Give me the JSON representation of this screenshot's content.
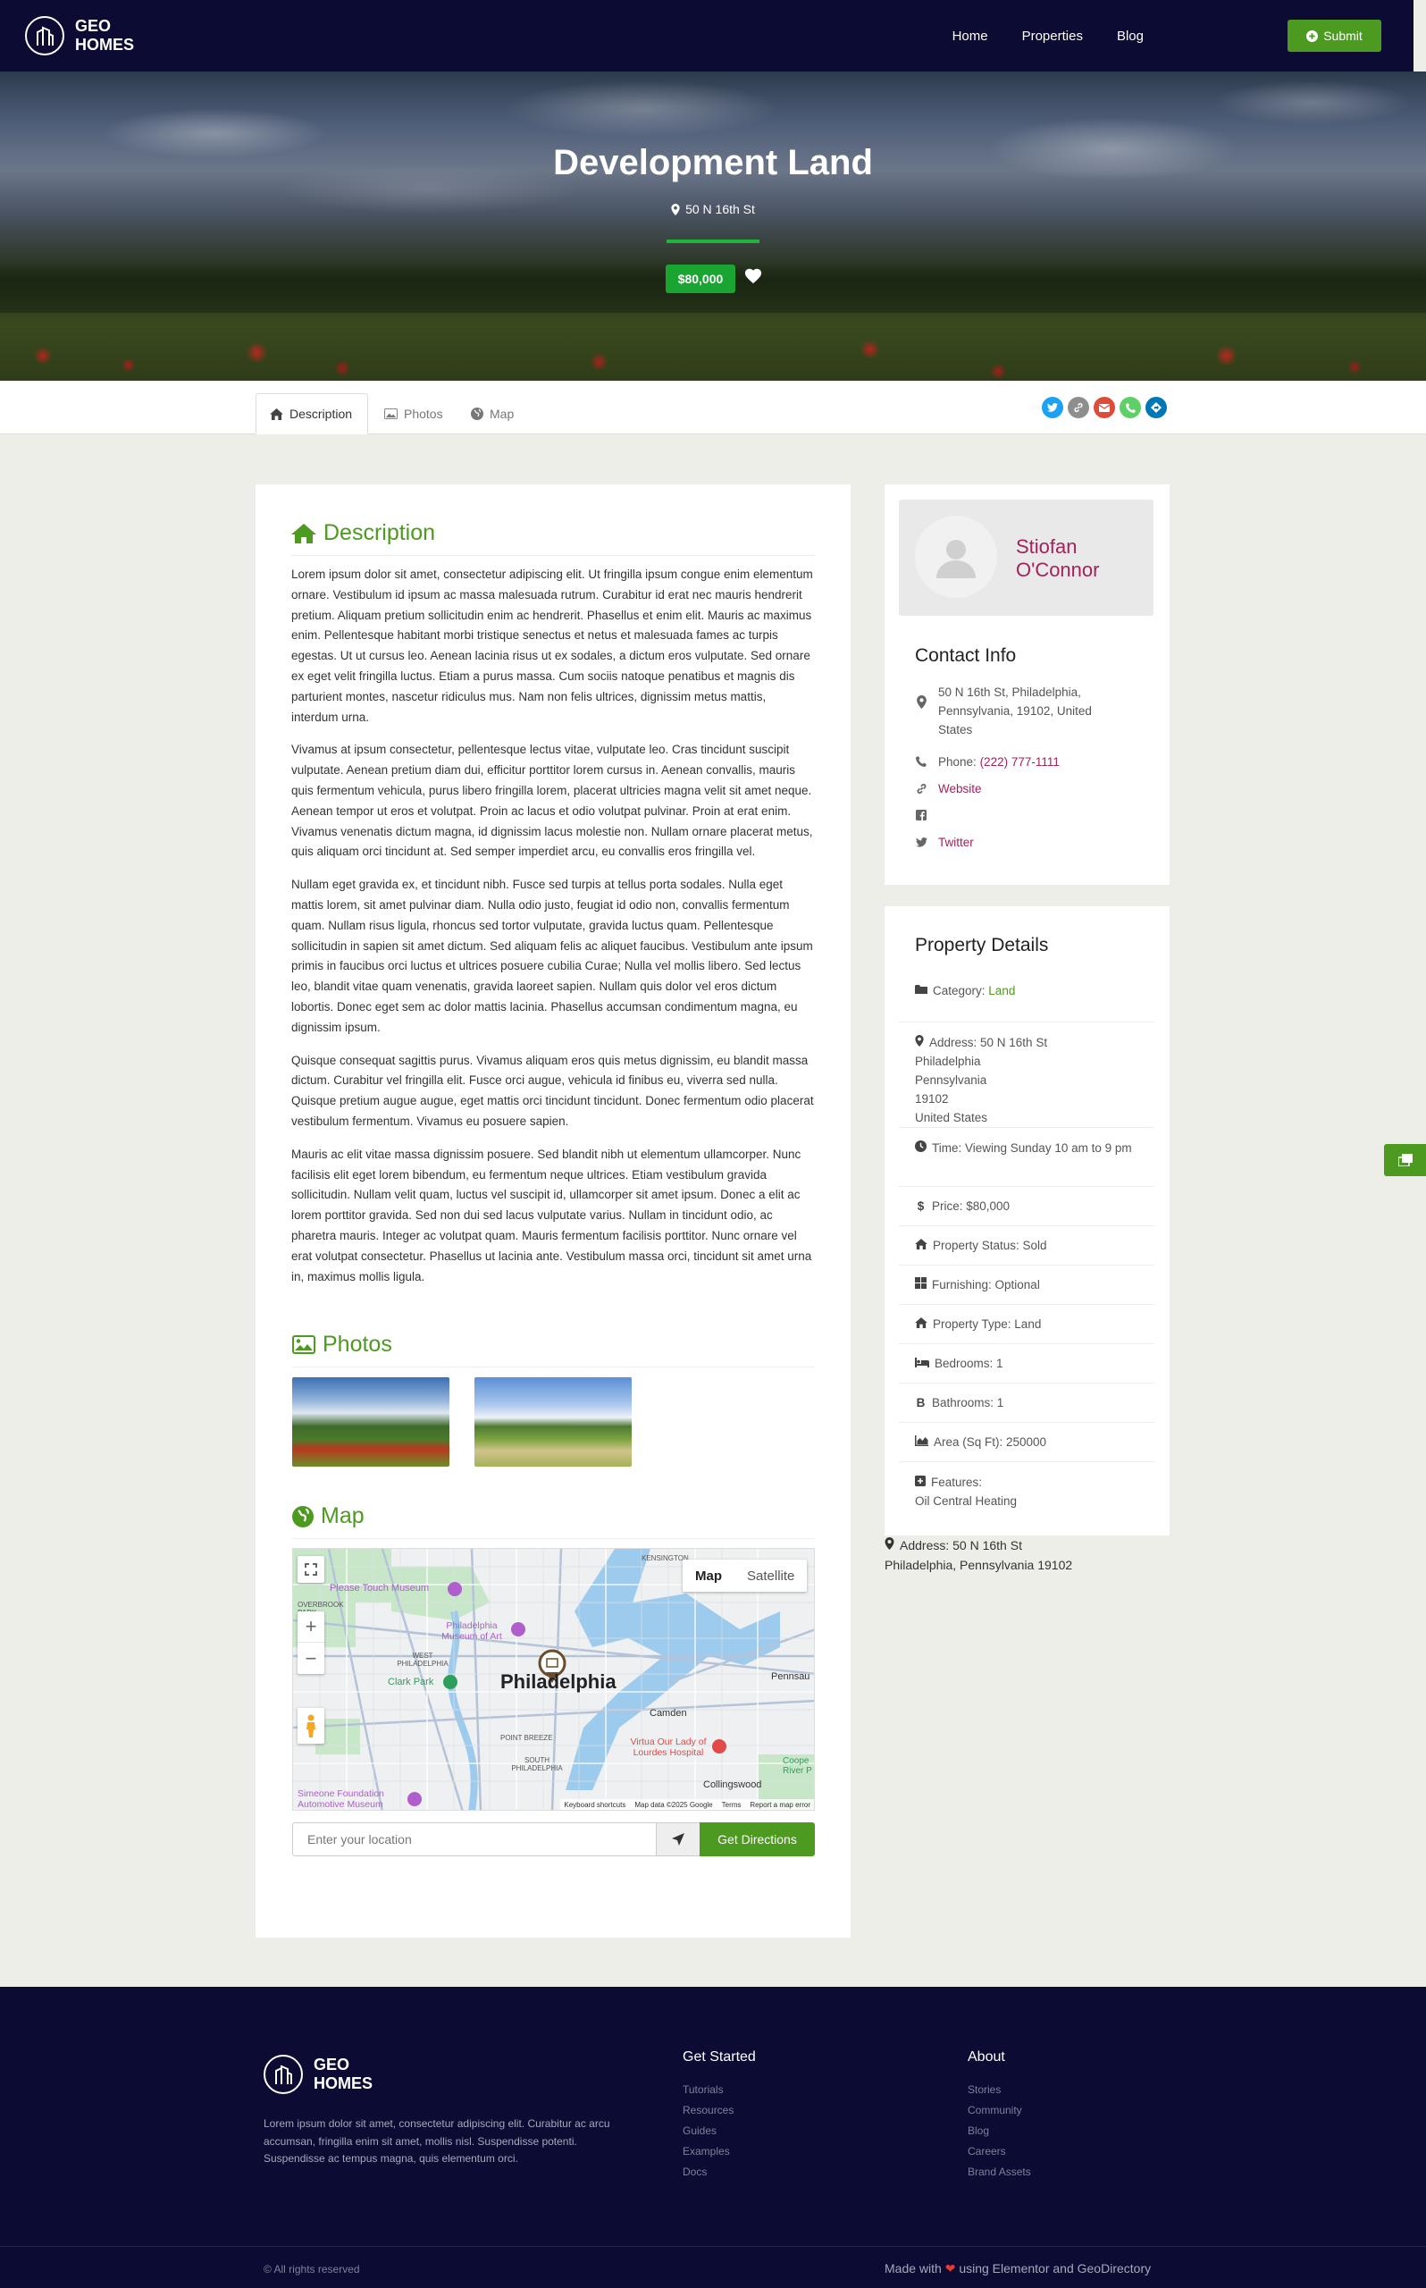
{
  "header": {
    "logo_line1": "GEO",
    "logo_line2": "HOMES",
    "nav": [
      "Home",
      "Properties",
      "Blog"
    ],
    "submit_label": "Submit"
  },
  "hero": {
    "title": "Development Land",
    "address": "50 N 16th St",
    "price": "$80,000"
  },
  "tabs": [
    "Description",
    "Photos",
    "Map"
  ],
  "share_colors": [
    "#1da1f2",
    "#8e8e8e",
    "#dd4b39",
    "#5fd068",
    "#0077b5"
  ],
  "description": {
    "heading": "Description",
    "paragraphs": [
      "Lorem ipsum dolor sit amet, consectetur adipiscing elit. Ut fringilla ipsum congue enim elementum ornare. Vestibulum id ipsum ac massa malesuada rutrum. Curabitur id erat nec mauris hendrerit pretium. Aliquam pretium sollicitudin enim ac hendrerit. Phasellus et enim elit. Mauris ac maximus enim. Pellentesque habitant morbi tristique senectus et netus et malesuada fames ac turpis egestas. Ut ut cursus leo. Aenean lacinia risus ut ex sodales, a dictum eros vulputate. Sed ornare ex eget velit fringilla luctus. Etiam a purus massa. Cum sociis natoque penatibus et magnis dis parturient montes, nascetur ridiculus mus. Nam non felis ultrices, dignissim metus mattis, interdum urna.",
      "Vivamus at ipsum consectetur, pellentesque lectus vitae, vulputate leo. Cras tincidunt suscipit vulputate. Aenean pretium diam dui, efficitur porttitor lorem cursus in. Aenean convallis, mauris quis fermentum vehicula, purus libero fringilla lorem, placerat ultricies magna velit sit amet neque. Aenean tempor ut eros et volutpat. Proin ac lacus et odio volutpat pulvinar. Proin at erat enim. Vivamus venenatis dictum magna, id dignissim lacus molestie non. Nullam ornare placerat metus, quis aliquam orci tincidunt at. Sed semper imperdiet arcu, eu convallis eros fringilla vel.",
      "Nullam eget gravida ex, et tincidunt nibh. Fusce sed turpis at tellus porta sodales. Nulla eget mattis lorem, sit amet pulvinar diam. Nulla odio justo, feugiat id odio non, convallis fermentum quam. Nullam risus ligula, rhoncus sed tortor vulputate, gravida luctus quam. Pellentesque sollicitudin in sapien sit amet dictum. Sed aliquam felis ac aliquet faucibus. Vestibulum ante ipsum primis in faucibus orci luctus et ultrices posuere cubilia Curae; Nulla vel mollis libero. Sed lectus leo, blandit vitae quam venenatis, gravida laoreet sapien. Nullam quis dolor vel eros dictum lobortis. Donec eget sem ac dolor mattis lacinia. Phasellus accumsan condimentum magna, eu dignissim ipsum.",
      "Quisque consequat sagittis purus. Vivamus aliquam eros quis metus dignissim, eu blandit massa dictum. Curabitur vel fringilla elit. Fusce orci augue, vehicula id finibus eu, viverra sed nulla. Quisque pretium augue augue, eget mattis orci tincidunt tincidunt. Donec fermentum odio placerat vestibulum fermentum. Vivamus eu posuere sapien.",
      "Mauris ac elit vitae massa dignissim posuere. Sed blandit nibh ut elementum ullamcorper. Nunc facilisis elit eget lorem bibendum, eu fermentum neque ultrices. Etiam vestibulum gravida sollicitudin. Nullam velit quam, luctus vel suscipit id, ullamcorper sit amet ipsum. Donec a elit ac lorem porttitor gravida. Sed non dui sed lacus vulputate varius. Nullam in tincidunt odio, ac pharetra mauris. Integer ac volutpat quam. Mauris fermentum facilisis porttitor. Nunc ornare vel erat volutpat consectetur. Phasellus ut lacinia ante. Vestibulum massa orci, tincidunt sit amet urna in, maximus mollis ligula."
    ]
  },
  "photos": {
    "heading": "Photos"
  },
  "map": {
    "heading": "Map",
    "type_map": "Map",
    "type_satellite": "Satellite",
    "city": "Philadelphia",
    "labels": [
      "Please Touch Museum",
      "Philadelphia Museum of Art",
      "Clark Park",
      "Camden",
      "Pennsau",
      "POINT BREEZE",
      "SOUTH PHILADELPHIA",
      "Virtua Our Lady of Lourdes Hospital",
      "Collingswood",
      "Simeone Foundation Automotive Museum",
      "OVERBROOK PARK",
      "WEST PHILADELPHIA",
      "KENSINGTON",
      "Coope River P"
    ],
    "attribution": [
      "Keyboard shortcuts",
      "Map data ©2025 Google",
      "Terms",
      "Report a map error"
    ],
    "location_placeholder": "Enter your location",
    "directions_label": "Get Directions"
  },
  "agent": {
    "name_line1": "Stiofan",
    "name_line2": "O'Connor",
    "contact_title": "Contact Info",
    "address_lines": [
      "50 N 16th St, Philadelphia,",
      "Pennsylvania, 19102, United",
      "States"
    ],
    "phone_label": "Phone:",
    "phone": "(222) 777-1111",
    "website": "Website",
    "twitter": "Twitter"
  },
  "details": {
    "title": "Property Details",
    "category_label": "Category:",
    "category_value": "Land",
    "address_label": "Address: 50 N 16th St",
    "address_lines": [
      "Philadelphia",
      "Pennsylvania",
      "19102",
      "United States"
    ],
    "time": "Time: Viewing Sunday 10 am to 9 pm",
    "price": "Price: $80,000",
    "status": "Property Status: Sold",
    "furnishing": "Furnishing: Optional",
    "type": "Property Type: Land",
    "bedrooms": "Bedrooms: 1",
    "bathrooms": "Bathrooms: 1",
    "area": "Area (Sq Ft): 250000",
    "features_label": "Features:",
    "features_value": "Oil Central Heating"
  },
  "side_address": {
    "line1": "Address: 50 N 16th St",
    "line2": "Philadelphia, Pennsylvania 19102"
  },
  "footer": {
    "logo_line1": "GEO",
    "logo_line2": "HOMES",
    "description": "Lorem ipsum dolor sit amet, consectetur adipiscing elit. Curabitur ac arcu accumsan, fringilla enim sit amet, mollis nisl. Suspendisse potenti. Suspendisse ac tempus magna, quis elementum orci.",
    "col1_title": "Get Started",
    "col1_links": [
      "Tutorials",
      "Resources",
      "Guides",
      "Examples",
      "Docs"
    ],
    "col2_title": "About",
    "col2_links": [
      "Stories",
      "Community",
      "Blog",
      "Careers",
      "Brand Assets"
    ],
    "copyright": "© All rights reserved",
    "made_prefix": "Made with",
    "made_suffix": "using Elementor and GeoDirectory"
  }
}
